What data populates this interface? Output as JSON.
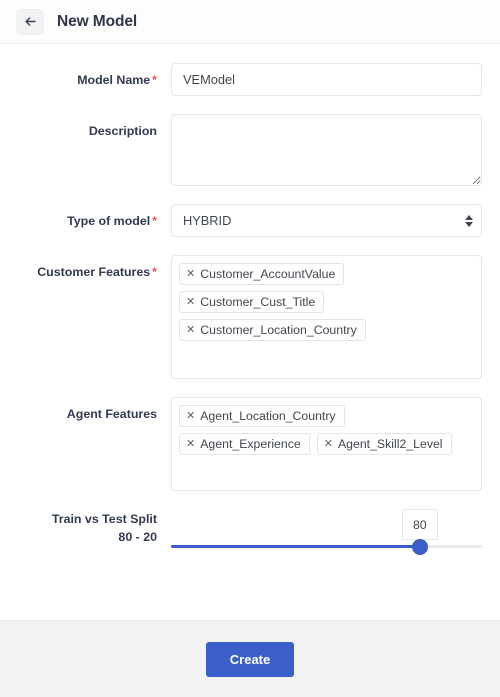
{
  "header": {
    "back_icon": "arrow-left-icon",
    "title": "New Model"
  },
  "form": {
    "model_name": {
      "label": "Model Name",
      "required_marker": "*",
      "value": "VEModel",
      "placeholder": ""
    },
    "description": {
      "label": "Description",
      "value": "",
      "placeholder": ""
    },
    "type_of_model": {
      "label": "Type of model",
      "required_marker": "*",
      "selected": "HYBRID",
      "options": [
        "HYBRID"
      ]
    },
    "customer_features": {
      "label": "Customer Features",
      "required_marker": "*",
      "remove_icon": "close-icon",
      "tags": [
        "Customer_AccountValue",
        "Customer_Cust_Title",
        "Customer_Location_Country"
      ]
    },
    "agent_features": {
      "label": "Agent Features",
      "remove_icon": "close-icon",
      "tags": [
        "Agent_Location_Country",
        "Agent_Experience",
        "Agent_Skill2_Level"
      ]
    },
    "train_test_split": {
      "label_line1": "Train vs Test Split",
      "label_line2": "80 - 20",
      "value": "80",
      "min": 0,
      "max": 100,
      "percent": 80
    }
  },
  "footer": {
    "create_label": "Create"
  },
  "colors": {
    "accent": "#3a5fc8",
    "required": "#f05050",
    "label_text": "#313a4e",
    "footer_bg": "#f2f2f3",
    "border": "#e4e6ec"
  }
}
